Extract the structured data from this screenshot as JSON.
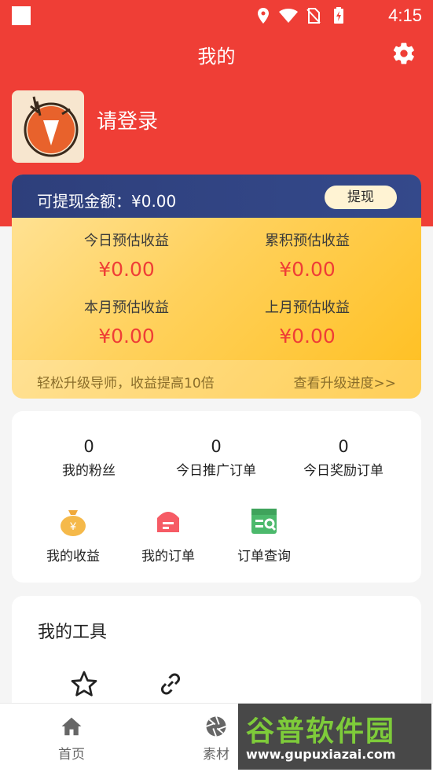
{
  "status_bar": {
    "time": "4:15"
  },
  "header": {
    "title": "我的",
    "login_text": "请登录"
  },
  "earnings": {
    "withdrawable_label": "可提现金额：¥0.00",
    "withdraw_button": "提现",
    "today_label": "今日预估收益",
    "today_value": "¥0.00",
    "total_label": "累积预估收益",
    "total_value": "¥0.00",
    "month_label": "本月预估收益",
    "month_value": "¥0.00",
    "last_month_label": "上月预估收益",
    "last_month_value": "¥0.00",
    "footer_left": "轻松升级导师，收益提高10倍",
    "footer_right": "查看升级进度>>"
  },
  "stats": [
    {
      "value": "0",
      "label": "我的粉丝"
    },
    {
      "value": "0",
      "label": "今日推广订单"
    },
    {
      "value": "0",
      "label": "今日奖励订单"
    }
  ],
  "functions": [
    {
      "label": "我的收益",
      "icon": "money-bag-icon"
    },
    {
      "label": "我的订单",
      "icon": "order-icon"
    },
    {
      "label": "订单查询",
      "icon": "order-search-icon"
    }
  ],
  "tools": {
    "title": "我的工具",
    "icons": [
      "star-icon",
      "link-icon"
    ]
  },
  "nav": [
    {
      "label": "首页",
      "icon": "home-icon"
    },
    {
      "label": "素材",
      "icon": "aperture-icon"
    }
  ],
  "watermark": {
    "line1": "谷普软件园",
    "line2": "www.gupuxiazai.com"
  },
  "colors": {
    "primary": "#ef3e36",
    "card_dark": "#2e3f7b",
    "gold": "#ffd15c"
  }
}
